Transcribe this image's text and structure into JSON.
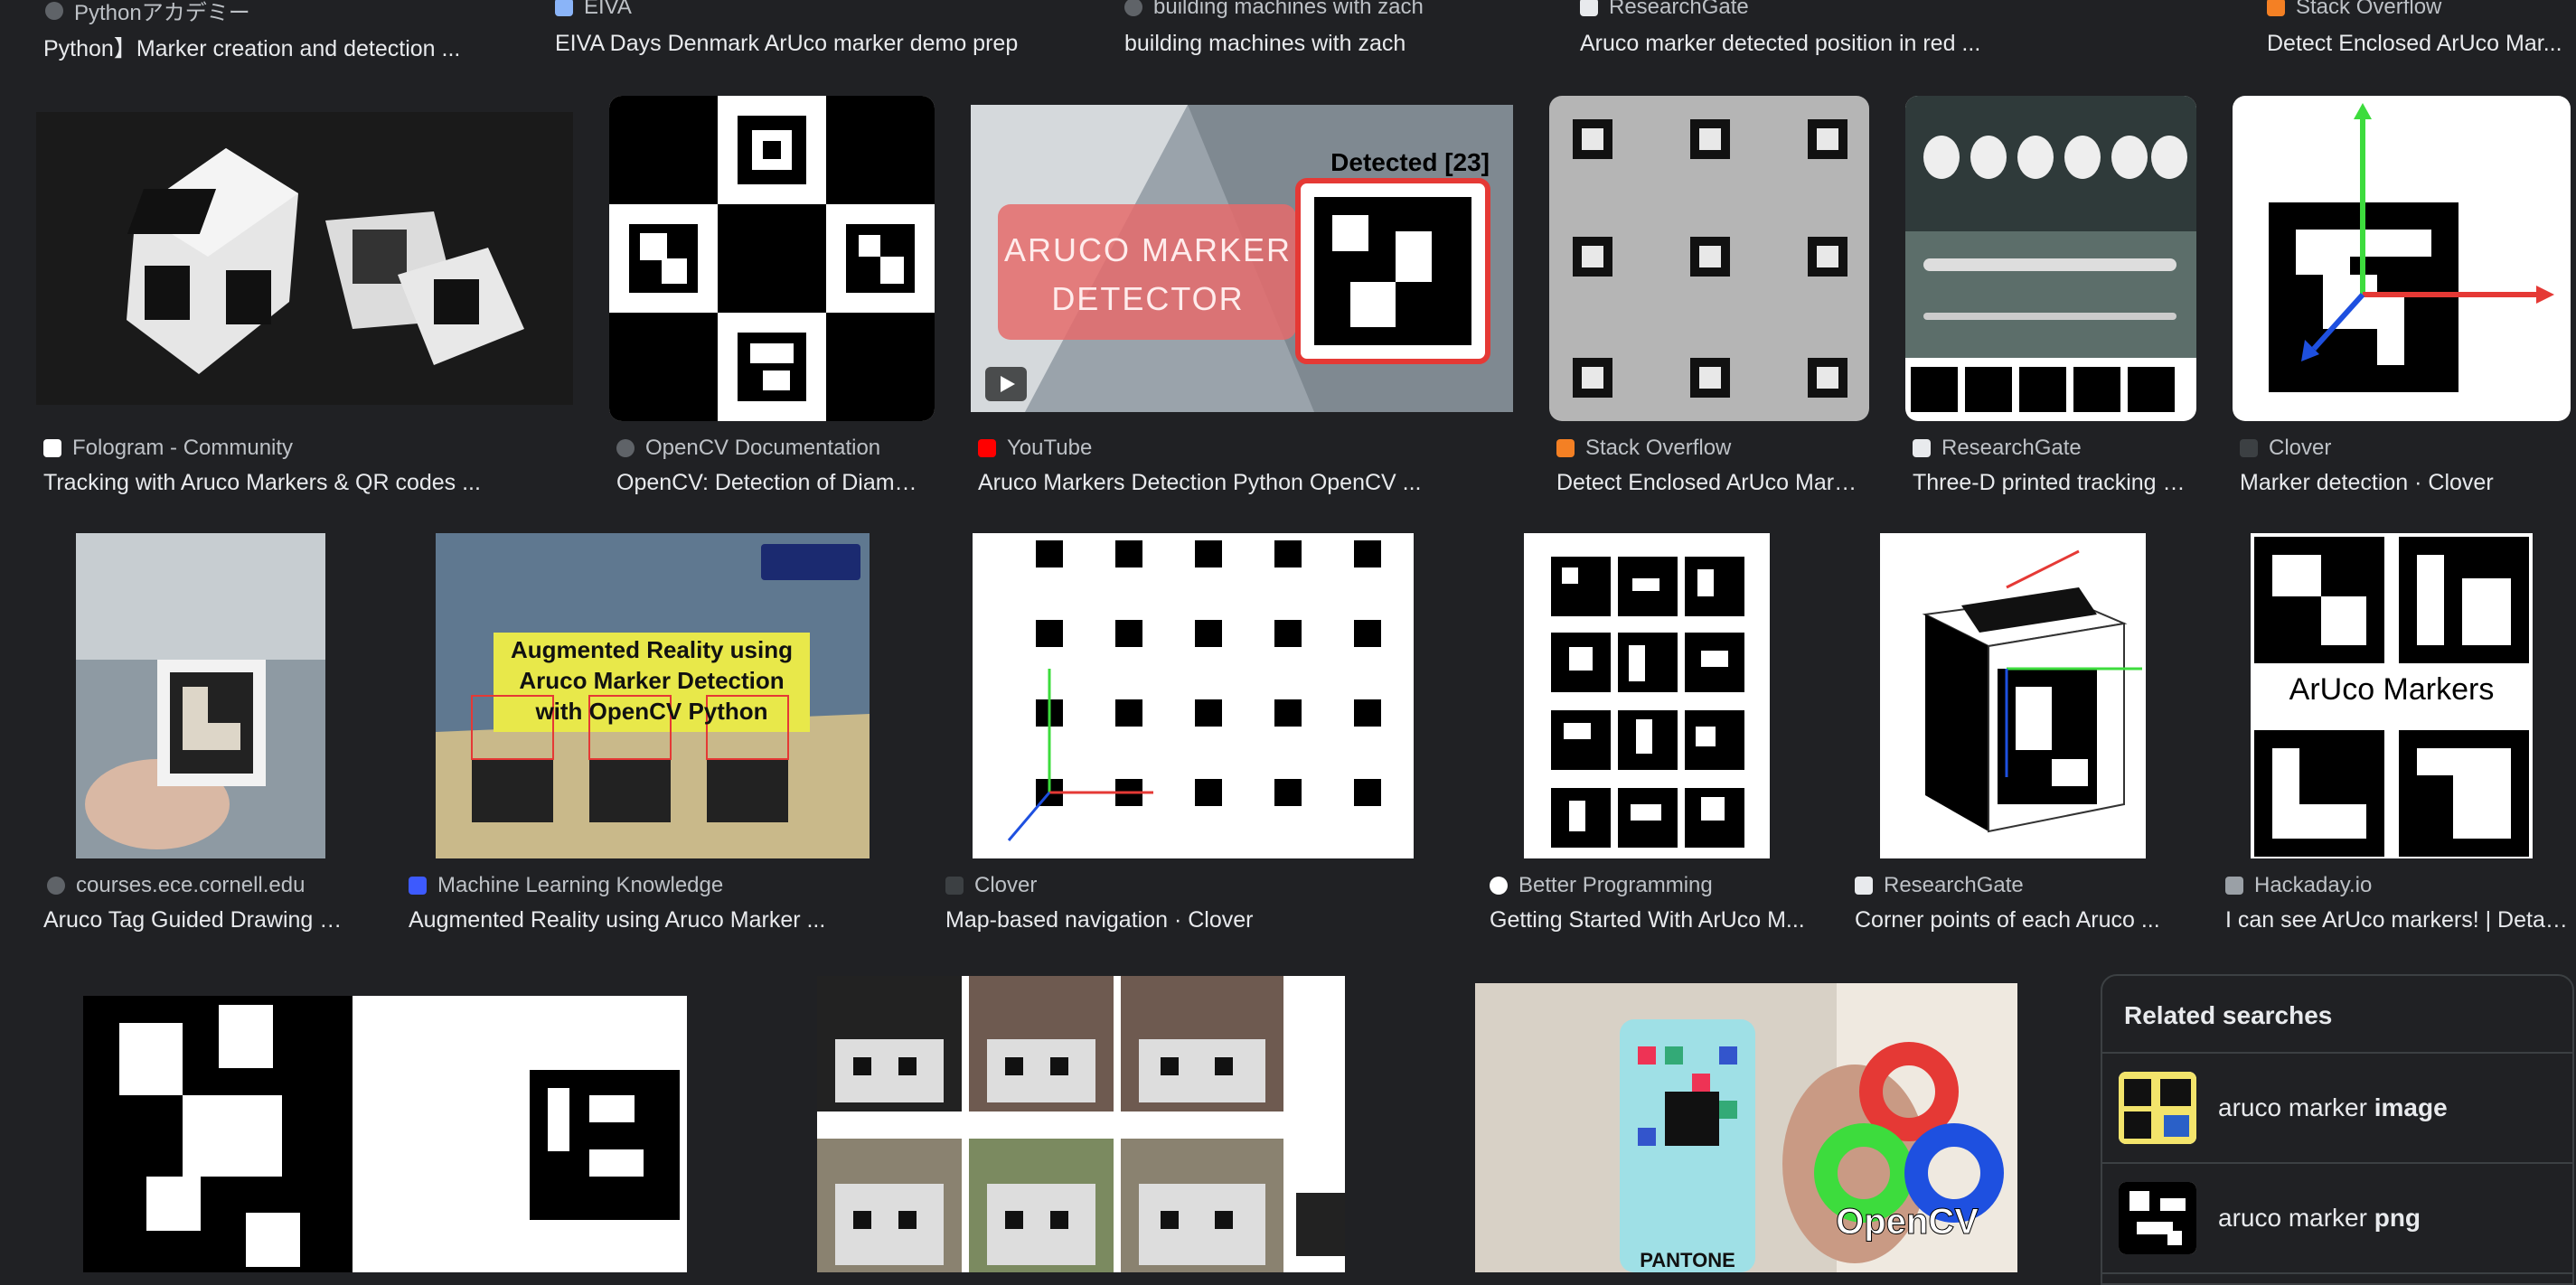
{
  "row0": [
    {
      "source": "Pythonアカデミー",
      "title": "Python】Marker creation and detection ..."
    },
    {
      "source": "EIVA",
      "title": "EIVA Days Denmark ArUco marker demo prep"
    },
    {
      "source": "building machines with zach",
      "title": "building machines with zach"
    },
    {
      "source": "ResearchGate",
      "title": "Aruco marker detected position in red ..."
    },
    {
      "source": "Stack Overflow",
      "title": "Detect Enclosed ArUco Mar..."
    }
  ],
  "row1": [
    {
      "source": "Fologram - Community",
      "title": "Tracking with Aruco Markers & QR codes ..."
    },
    {
      "source": "OpenCV Documentation",
      "title": "OpenCV: Detection of Diamo..."
    },
    {
      "source": "YouTube",
      "title": "Aruco Markers Detection Python OpenCV ..."
    },
    {
      "source": "Stack Overflow",
      "title": "Detect Enclosed ArUco Mark..."
    },
    {
      "source": "ResearchGate",
      "title": "Three-D printed tracking d..."
    },
    {
      "source": "Clover",
      "title": "Marker detection · Clover"
    }
  ],
  "row2": [
    {
      "source": "courses.ece.cornell.edu",
      "title": "Aruco Tag Guided Drawing Ro..."
    },
    {
      "source": "Machine Learning Knowledge",
      "title": "Augmented Reality using Aruco Marker ..."
    },
    {
      "source": "Clover",
      "title": "Map-based navigation · Clover"
    },
    {
      "source": "Better Programming",
      "title": "Getting Started With ArUco M..."
    },
    {
      "source": "ResearchGate",
      "title": "Corner points of each Aruco ..."
    },
    {
      "source": "Hackaday.io",
      "title": "I can see ArUco markers! | Detai..."
    }
  ],
  "thumb_text": {
    "yt_banner": "ARUCO MARKER DETECTOR",
    "yt_detected": "Detected [23]",
    "ar_title": "Augmented Reality using Aruco Marker Detection with OpenCV Python",
    "hack_label": "ArUco Markers",
    "opencv_label": "OpenCV",
    "pantone": "PANTONE"
  },
  "related": {
    "heading": "Related searches",
    "items": [
      {
        "prefix": "aruco marker ",
        "bold": "image"
      },
      {
        "prefix": "aruco marker ",
        "bold": "png"
      }
    ]
  },
  "colors": {
    "background": "#202124",
    "title": "#e8eaed",
    "source": "#bdc1c6",
    "youtube_red": "#ff0000",
    "detect_red": "#e53935"
  }
}
